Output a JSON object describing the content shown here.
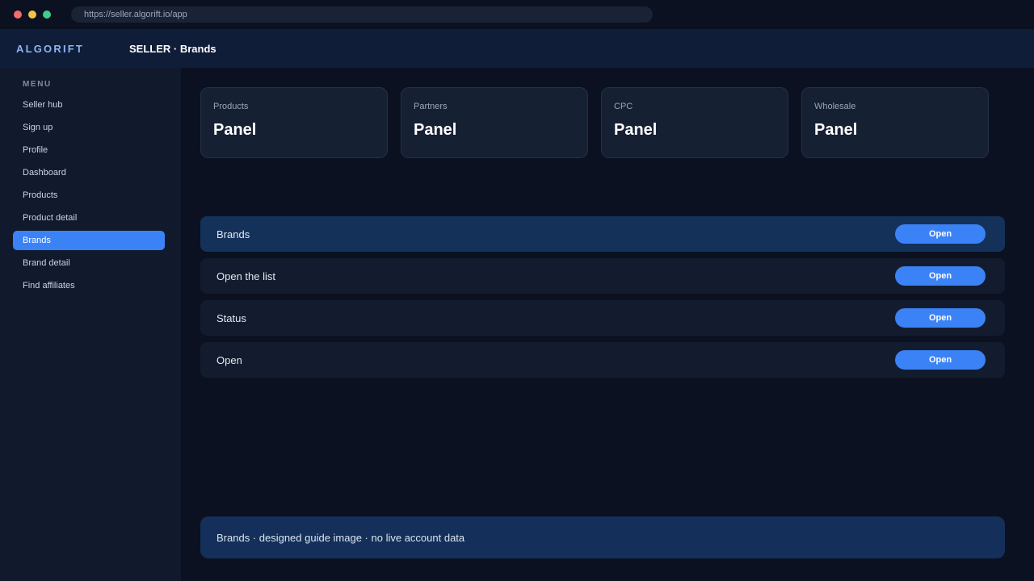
{
  "browser": {
    "url": "https://seller.algorift.io/app"
  },
  "header": {
    "logo": "ALGORIFT",
    "title": "SELLER · Brands"
  },
  "sidebar": {
    "heading": "MENU",
    "items": [
      {
        "label": "Seller hub"
      },
      {
        "label": "Sign up"
      },
      {
        "label": "Profile"
      },
      {
        "label": "Dashboard"
      },
      {
        "label": "Products"
      },
      {
        "label": "Product detail"
      },
      {
        "label": "Brands",
        "active": true
      },
      {
        "label": "Brand detail"
      },
      {
        "label": "Find affiliates"
      }
    ]
  },
  "cards": [
    {
      "label": "Products",
      "value": "Panel"
    },
    {
      "label": "Partners",
      "value": "Panel"
    },
    {
      "label": "CPC",
      "value": "Panel"
    },
    {
      "label": "Wholesale",
      "value": "Panel"
    }
  ],
  "rows": [
    {
      "label": "Brands",
      "button": "Open",
      "active": true
    },
    {
      "label": "Open the list",
      "button": "Open"
    },
    {
      "label": "Status",
      "button": "Open"
    },
    {
      "label": "Open",
      "button": "Open"
    }
  ],
  "footer": {
    "text": "Brands · designed guide image · no live account data"
  },
  "colors": {
    "accent": "#3b82f6",
    "background": "#0b1120",
    "sidebar": "#101a2c",
    "active_row": "#14315a"
  }
}
